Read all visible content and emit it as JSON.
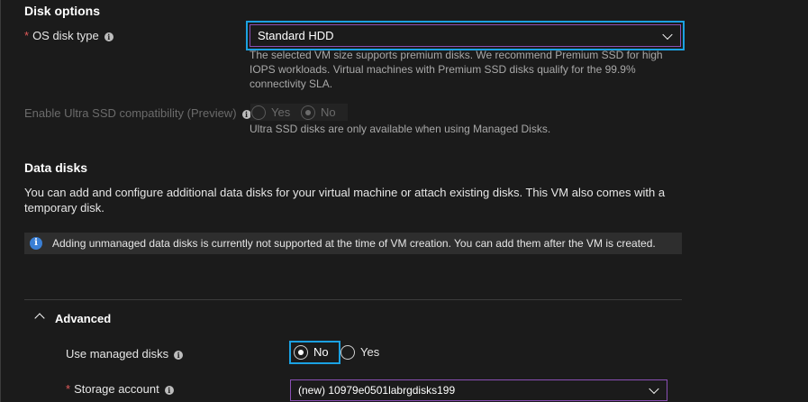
{
  "disk_options": {
    "heading": "Disk options",
    "os_disk_type": {
      "required_mark": "*",
      "label": "OS disk type",
      "value": "Standard HDD",
      "help": [
        "The selected VM size supports premium disks. We recommend Premium SSD for high",
        "IOPS workloads. Virtual machines with Premium SSD disks qualify for the 99.9%",
        "connectivity SLA."
      ]
    },
    "ultra_ssd": {
      "label": "Enable Ultra SSD compatibility (Preview)",
      "option_yes": "Yes",
      "option_no": "No",
      "selected": "No",
      "help": "Ultra SSD disks are only available when using Managed Disks."
    }
  },
  "data_disks": {
    "heading": "Data disks",
    "description": [
      "You can add and configure additional data disks for your virtual machine or attach existing disks. This VM also comes with a",
      "temporary disk."
    ],
    "info_banner": "Adding unmanaged data disks is currently not supported at the time of VM creation. You can add them after the VM is created."
  },
  "advanced": {
    "heading": "Advanced",
    "managed_disks": {
      "label": "Use managed disks",
      "option_no": "No",
      "option_yes": "Yes",
      "selected": "No"
    },
    "storage_account": {
      "required_mark": "*",
      "label": "Storage account",
      "value": "(new) 10979e0501labrgdisks199"
    }
  },
  "icons": {
    "info": "i",
    "collapse": "chevron-up"
  },
  "colors": {
    "background": "#1b1b1b",
    "focus": "#1ba1e2",
    "select_border": "#8a4fb5",
    "required": "#e05a5a",
    "info_blue": "#3a7fd5"
  }
}
